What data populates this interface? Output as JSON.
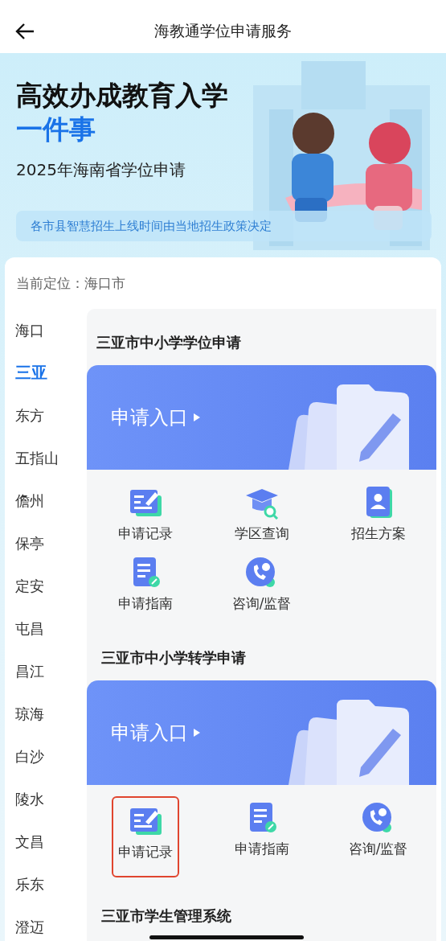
{
  "nav": {
    "title": "海教通学位申请服务"
  },
  "banner": {
    "title": "高效办成教育入学",
    "title_accent": "一件事",
    "subtitle": "2025年海南省学位申请",
    "notice": "各市县智慧招生上线时间由当地招生政策决定"
  },
  "location": {
    "label": "当前定位：",
    "value": "海口市"
  },
  "cities": [
    {
      "name": "海口",
      "selected": false
    },
    {
      "name": "三亚",
      "selected": true
    },
    {
      "name": "东方",
      "selected": false
    },
    {
      "name": "五指山",
      "selected": false
    },
    {
      "name": "儋州",
      "selected": false
    },
    {
      "name": "保亭",
      "selected": false
    },
    {
      "name": "定安",
      "selected": false
    },
    {
      "name": "屯昌",
      "selected": false
    },
    {
      "name": "昌江",
      "selected": false
    },
    {
      "name": "琼海",
      "selected": false
    },
    {
      "name": "白沙",
      "selected": false
    },
    {
      "name": "陵水",
      "selected": false
    },
    {
      "name": "文昌",
      "selected": false
    },
    {
      "name": "乐东",
      "selected": false
    },
    {
      "name": "澄迈",
      "selected": false
    }
  ],
  "sections": [
    {
      "title": "三亚市中小学学位申请",
      "entry": "申请入口",
      "items": [
        {
          "label": "申请记录",
          "kind": "record",
          "highlighted": false
        },
        {
          "label": "学区查询",
          "kind": "query",
          "highlighted": false
        },
        {
          "label": "招生方案",
          "kind": "plan",
          "highlighted": false
        },
        {
          "label": "申请指南",
          "kind": "guide",
          "highlighted": false
        },
        {
          "label": "咨询/监督",
          "kind": "consult",
          "highlighted": false
        }
      ]
    },
    {
      "title": "三亚市中小学转学申请",
      "entry": "申请入口",
      "items": [
        {
          "label": "申请记录",
          "kind": "record",
          "highlighted": true
        },
        {
          "label": "申请指南",
          "kind": "guide",
          "highlighted": false
        },
        {
          "label": "咨询/监督",
          "kind": "consult",
          "highlighted": false
        }
      ]
    },
    {
      "title": "三亚市学生管理系统"
    }
  ]
}
